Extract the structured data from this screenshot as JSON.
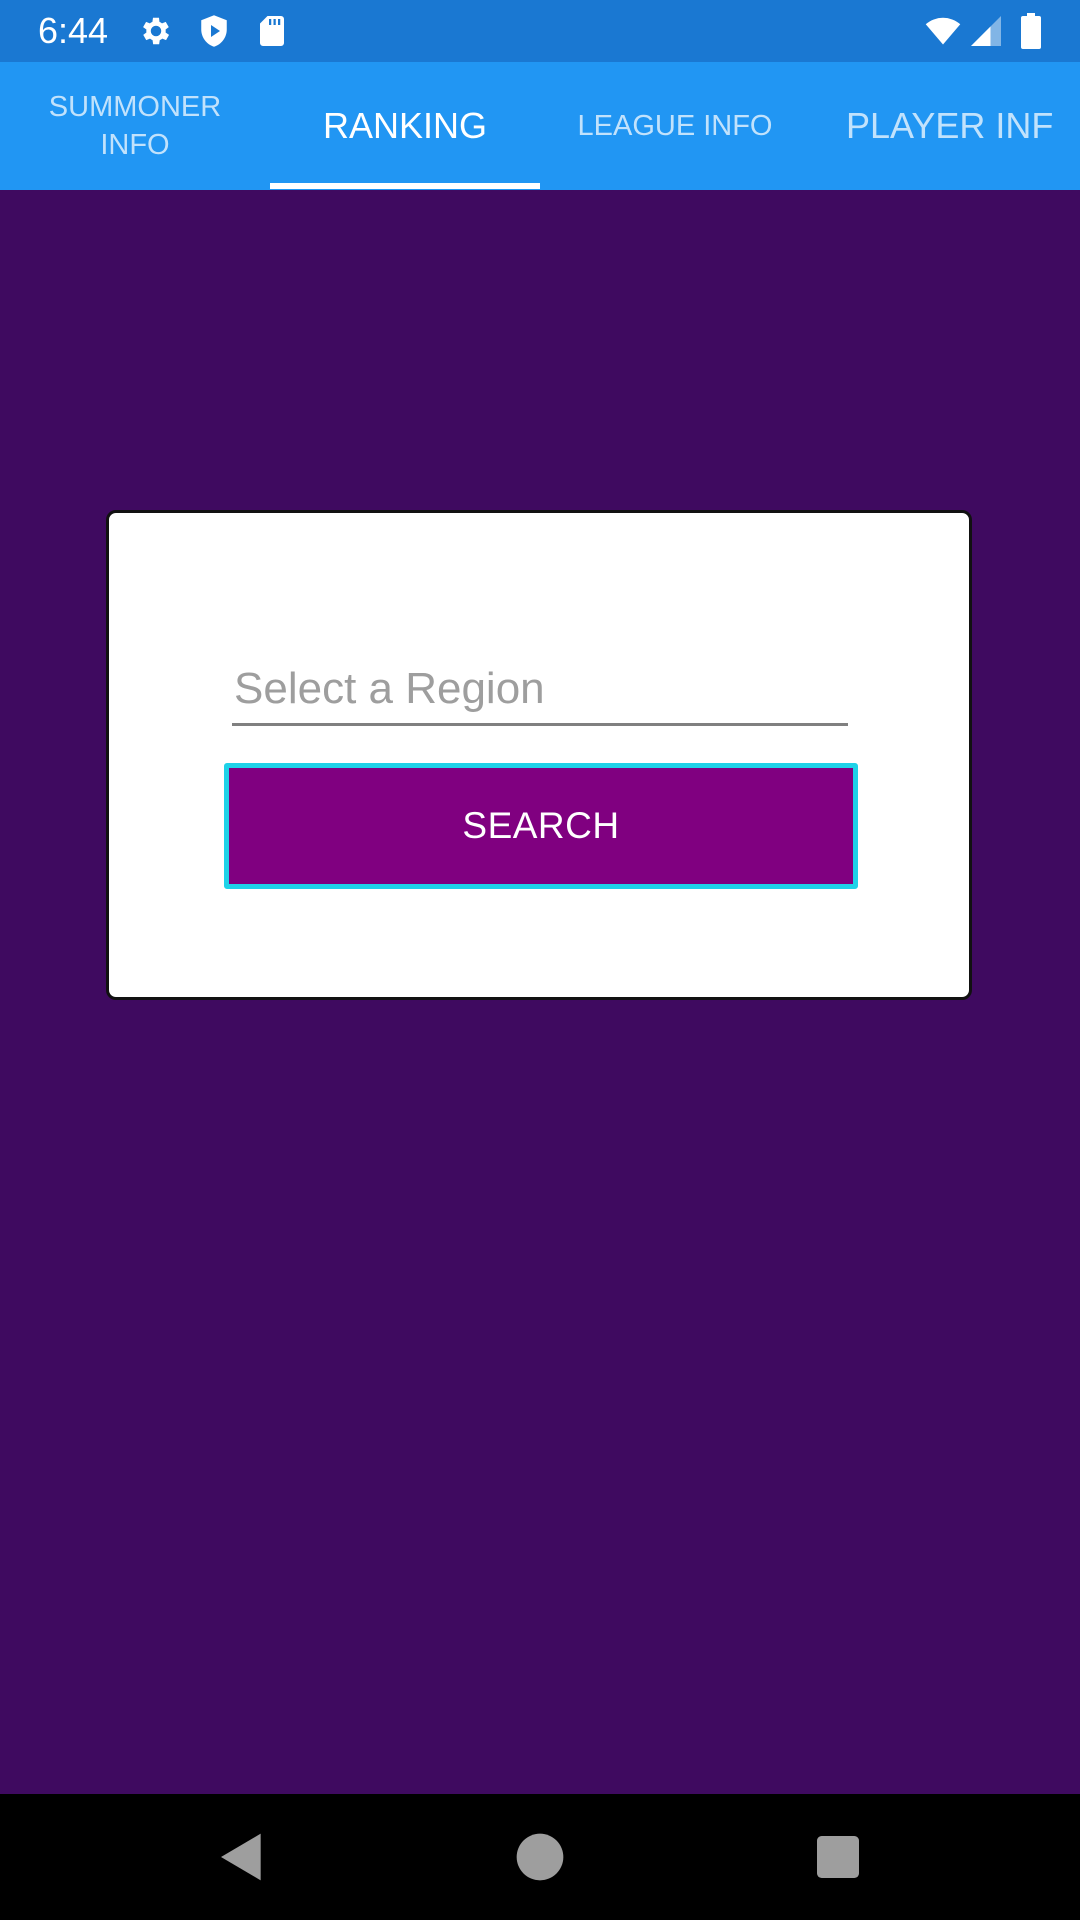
{
  "status_bar": {
    "time": "6:44",
    "icons_left": [
      "gear-icon",
      "shield-play-icon",
      "sd-card-icon"
    ],
    "icons_right": [
      "wifi-icon",
      "cell-signal-icon",
      "battery-icon"
    ]
  },
  "tabs": [
    {
      "label": "SUMMONER\nINFO",
      "active": false
    },
    {
      "label": "RANKING",
      "active": true
    },
    {
      "label": "LEAGUE INFO",
      "active": false
    },
    {
      "label": "PLAYER INF",
      "active": false
    }
  ],
  "form": {
    "region_placeholder": "Select a Region",
    "region_value": "",
    "search_label": "SEARCH"
  },
  "nav_bar": {
    "buttons": [
      "back-icon",
      "home-icon",
      "recents-icon"
    ]
  },
  "colors": {
    "status_bar": "#1a78d2",
    "tab_bar": "#2196f3",
    "background": "#3f0a60",
    "search_button": "#800080",
    "search_button_border": "#1ed2e8"
  }
}
